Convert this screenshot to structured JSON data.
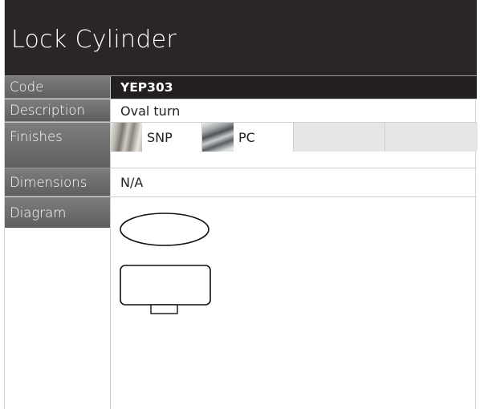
{
  "header": {
    "title": "Lock Cylinder"
  },
  "rows": {
    "code": {
      "label": "Code",
      "value": "YEP303"
    },
    "description": {
      "label": "Description",
      "value": "Oval turn"
    },
    "finishes": {
      "label": "Finishes",
      "items": [
        {
          "name": "SNP",
          "swatch": "satin-nickel-swatch"
        },
        {
          "name": "PC",
          "swatch": "polished-chrome-swatch"
        }
      ]
    },
    "dimensions": {
      "label": "Dimensions",
      "value": "N/A"
    },
    "diagram": {
      "label": "Diagram"
    }
  },
  "colors": {
    "title_bg": "#2a2626",
    "label_bg": "#6e6e6e",
    "code_bg": "#231f20",
    "empty_cell": "#e6e6e6"
  }
}
